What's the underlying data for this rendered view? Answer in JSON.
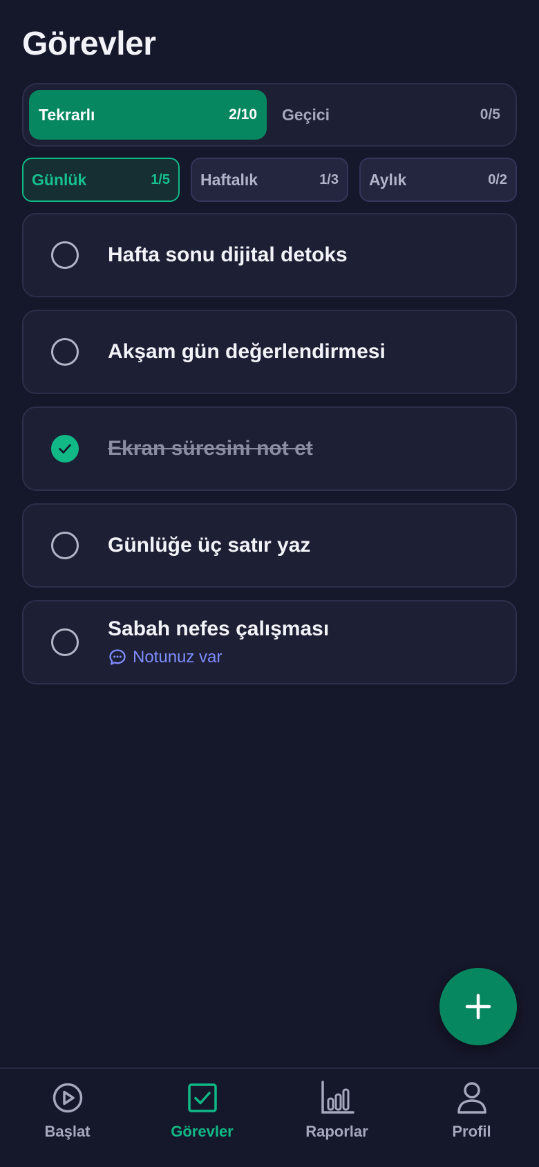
{
  "header": {
    "title": "Görevler"
  },
  "segments": [
    {
      "label": "Tekrarlı",
      "count": "2/10",
      "active": true
    },
    {
      "label": "Geçici",
      "count": "0/5",
      "active": false
    }
  ],
  "filters": [
    {
      "label": "Günlük",
      "count": "1/5",
      "active": true
    },
    {
      "label": "Haftalık",
      "count": "1/3",
      "active": false
    },
    {
      "label": "Aylık",
      "count": "0/2",
      "active": false
    }
  ],
  "tasks": [
    {
      "title": "Hafta sonu dijital detoks",
      "done": false
    },
    {
      "title": "Akşam gün değerlendirmesi",
      "done": false
    },
    {
      "title": "Ekran süresini not et",
      "done": true
    },
    {
      "title": "Günlüğe üç satır yaz",
      "done": false
    },
    {
      "title": "Sabah nefes çalışması",
      "done": false,
      "note": "Notunuz var"
    }
  ],
  "fab": {
    "icon": "plus-icon"
  },
  "nav": [
    {
      "label": "Başlat",
      "icon": "play-circle-icon",
      "active": false
    },
    {
      "label": "Görevler",
      "icon": "checkbox-icon",
      "active": true
    },
    {
      "label": "Raporlar",
      "icon": "bar-chart-icon",
      "active": false
    },
    {
      "label": "Profil",
      "icon": "user-icon",
      "active": false
    }
  ],
  "colors": {
    "background": "#15172a",
    "accent": "#10b986",
    "accent_dark": "#07875f",
    "note": "#7f8cff"
  }
}
